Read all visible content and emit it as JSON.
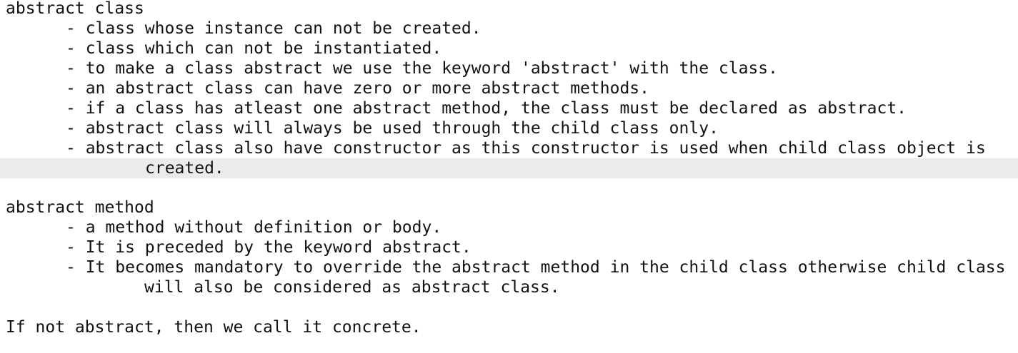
{
  "colors": {
    "background": "#ffffff",
    "text": "#111111",
    "current_line_highlight": "#ebebeb"
  },
  "document": {
    "lines": [
      "abstract class",
      "- class whose instance can not be created.",
      "- class which can not be instantiated.",
      "- to make a class abstract we use the keyword 'abstract' with the class.",
      "- an abstract class can have zero or more abstract methods.",
      "- if a class has atleast one abstract method, the class must be declared as abstract.",
      "- abstract class will always be used through the child class only.",
      "- abstract class also have constructor as this constructor is used when child class object is",
      "created.",
      "",
      "abstract method",
      "- a method without definition or body.",
      "- It is preceded by the keyword abstract.",
      "- It becomes mandatory to override the abstract method in the child class otherwise child class",
      "will also be considered as abstract class.",
      "",
      "If not abstract, then we call it concrete."
    ]
  }
}
